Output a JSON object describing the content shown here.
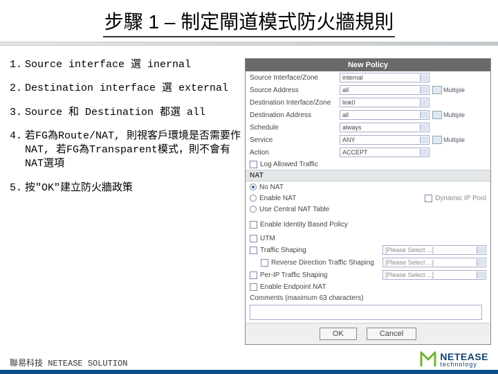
{
  "title": "步驟 1 – 制定閘道模式防火牆規則",
  "steps": [
    {
      "n": "1.",
      "t": "Source interface  選 inernal"
    },
    {
      "n": "2.",
      "t": "Destination interface 選 external"
    },
    {
      "n": "3.",
      "t": "Source 和 Destination 都選 all"
    },
    {
      "n": "4.",
      "t": "若FG為Route/NAT, 則視客戶環境是否需要作NAT, 若FG為Transparent模式，則不會有NAT選項"
    },
    {
      "n": "5.",
      "t": "按\"OK\"建立防火牆政策"
    }
  ],
  "panel": {
    "title": "New Policy",
    "rows": {
      "src_if_lbl": "Source Interface/Zone",
      "src_if_val": "internal",
      "src_addr_lbl": "Source Address",
      "src_addr_val": "all",
      "dst_if_lbl": "Destination Interface/Zone",
      "dst_if_val": "link0",
      "dst_addr_lbl": "Destination Address",
      "dst_addr_val": "all",
      "sched_lbl": "Schedule",
      "sched_val": "always",
      "svc_lbl": "Service",
      "svc_val": "ANY",
      "act_lbl": "Action",
      "act_val": "ACCEPT",
      "log_lbl": "Log Allowed Traffic",
      "nat_hdr": "NAT",
      "nat_no": "No NAT",
      "nat_en": "Enable NAT",
      "nat_dynip": "Dynamic IP Pool",
      "nat_central": "Use Central NAT Table",
      "ident_lbl": "Enable Identity Based Policy",
      "utm_lbl": "UTM",
      "ts_lbl": "Traffic Shaping",
      "ts_val": "[Please Select ...]",
      "rts_lbl": "Reverse Direction Traffic Shaping",
      "rts_val": "[Please Select ...]",
      "pip_lbl": "Per-IP Traffic Shaping",
      "pip_val": "[Please Select ...]",
      "endnat_lbl": "Enable Endpoint NAT",
      "comments_lbl": "Comments (maximum 63 characters)",
      "multiple": "Multiple"
    },
    "buttons": {
      "ok": "OK",
      "cancel": "Cancel"
    }
  },
  "footer": {
    "left": "聯易科技  NETEASE SOLUTION",
    "logo1": "NETEASE",
    "logo2": "technology"
  }
}
